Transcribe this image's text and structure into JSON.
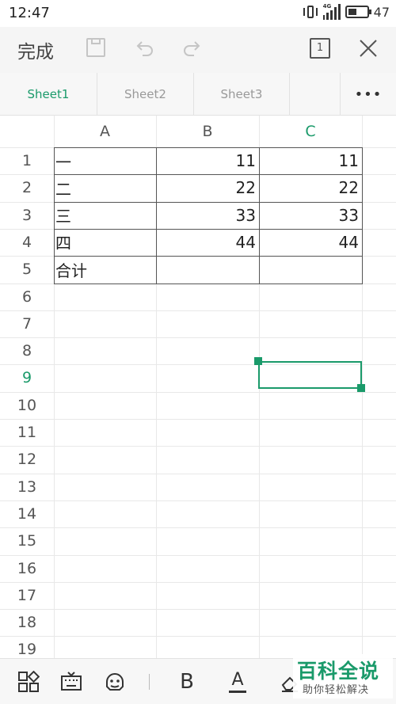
{
  "status": {
    "time": "12:47",
    "network": "4G",
    "battery": "47"
  },
  "toolbar": {
    "done_label": "完成",
    "page_count": "1",
    "icons": [
      "save-icon",
      "undo-icon",
      "redo-icon",
      "page-icon",
      "close-icon"
    ]
  },
  "tabs": {
    "items": [
      {
        "label": "Sheet1",
        "active": true
      },
      {
        "label": "Sheet2",
        "active": false
      },
      {
        "label": "Sheet3",
        "active": false
      }
    ],
    "more_label": "•••"
  },
  "grid": {
    "columns": [
      "A",
      "B",
      "C"
    ],
    "selected_column": "C",
    "rows": [
      "1",
      "2",
      "3",
      "4",
      "5",
      "6",
      "7",
      "8",
      "9",
      "10",
      "11",
      "12",
      "13",
      "14",
      "15",
      "16",
      "17",
      "18",
      "19"
    ],
    "selected_row": "9",
    "cells": [
      {
        "a": "一",
        "b": "11",
        "c": "11"
      },
      {
        "a": "二",
        "b": "22",
        "c": "22"
      },
      {
        "a": "三",
        "b": "33",
        "c": "33"
      },
      {
        "a": "四",
        "b": "44",
        "c": "44"
      },
      {
        "a": "合计",
        "b": "",
        "c": ""
      }
    ],
    "selected_cell": "C9"
  },
  "bottombar": {
    "bold_label": "B",
    "font_color_label": "A",
    "icons": [
      "apps-icon",
      "keyboard-icon",
      "emoji-icon",
      "bold-icon",
      "font-color-icon",
      "eraser-icon"
    ]
  },
  "colors": {
    "accent": "#1a9a6a",
    "toolbar_bg": "#f5f5f5",
    "gridline": "#e8e8e8",
    "border": "#555555"
  },
  "watermark": {
    "title": "百科全说",
    "subtitle": "助你轻松解决"
  }
}
